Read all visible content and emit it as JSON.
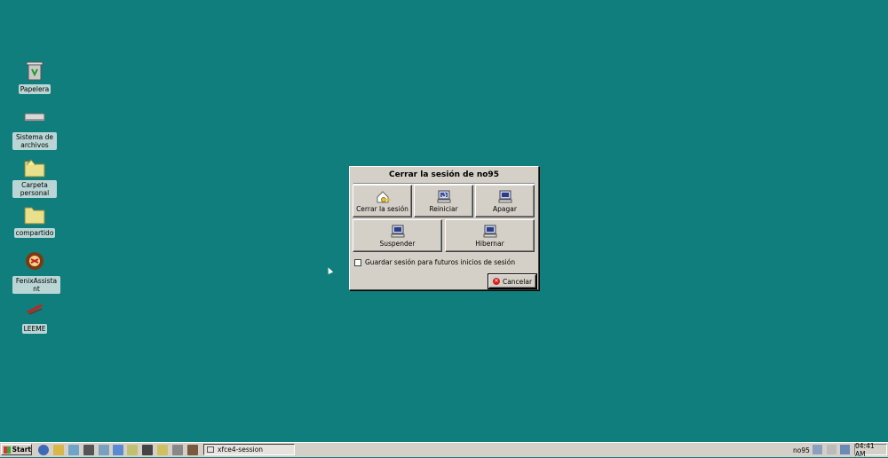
{
  "desktop": {
    "icons": [
      {
        "label": "Papelera",
        "icon": "trash-icon"
      },
      {
        "label": "Sistema de archivos",
        "icon": "drive-icon"
      },
      {
        "label": "Carpeta personal",
        "icon": "home-folder-icon"
      },
      {
        "label": "compartido",
        "icon": "folder-icon"
      },
      {
        "label": "FenixAssistant",
        "icon": "fenix-assistant-icon"
      },
      {
        "label": "LEEME",
        "icon": "readme-icon"
      }
    ]
  },
  "dialog": {
    "title": "Cerrar la sesión de no95",
    "buttons": {
      "logout": "Cerrar la sesión",
      "restart": "Reiniciar",
      "shutdown": "Apagar",
      "suspend": "Suspender",
      "hibernate": "Hibernar"
    },
    "save_session_label": "Guardar sesión para futuros inicios de sesión",
    "save_session_checked": false,
    "cancel_label": "Cancelar"
  },
  "taskbar": {
    "start_label": "Start",
    "active_task": "xfce4-session",
    "user": "no95",
    "clock": "04:41 AM"
  },
  "colors": {
    "desktop_bg": "#107e7d",
    "chrome": "#d4d0c8"
  }
}
